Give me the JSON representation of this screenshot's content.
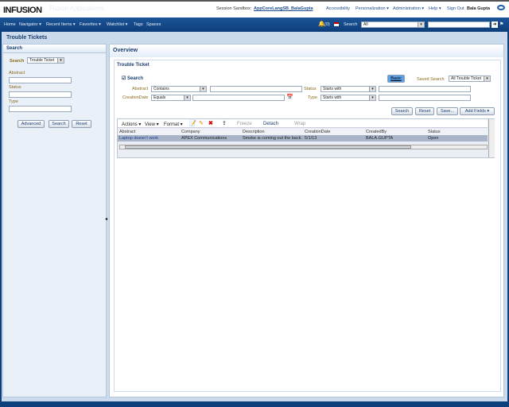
{
  "header": {
    "logo": "INFUSION",
    "app_title": "Fusion Applications",
    "session_label": "Session Sandbox:",
    "session_name": "AppCoreLangSB_BalaGupta",
    "links": [
      "Accessibility",
      "Personalization ▾",
      "Administration ▾",
      "Help ▾",
      "Sign Out"
    ],
    "user": "Bala Gupta"
  },
  "nav": {
    "items": [
      "Home",
      "Navigator ▾",
      "Recent Items ▾",
      "Favorites ▾",
      "Watchlist ▾",
      "Tags",
      "Spaces"
    ],
    "notifications": "(0)",
    "search_label": "Search",
    "search_scope": "All",
    "search_value": ""
  },
  "page_title": "Trouble Tickets",
  "left": {
    "title": "Search",
    "search_label": "Search",
    "search_object": "Trouble Ticket",
    "fields": [
      "Abstract",
      "Status",
      "Type"
    ],
    "buttons": [
      "Advanced",
      "Search",
      "Reset"
    ]
  },
  "main": {
    "title": "Overview",
    "section": "Trouble Ticket",
    "search_toggle": "Search",
    "basic": "Basic",
    "saved_search_label": "Saved Search",
    "saved_search": "All Trouble Ticket",
    "criteria": [
      {
        "label": "Abstract",
        "op": "Contains"
      },
      {
        "label": "CreationDate",
        "op": "Equals"
      },
      {
        "label": "Status",
        "op": "Starts with"
      },
      {
        "label": "Type",
        "op": "Starts with"
      }
    ],
    "buttons": [
      "Search",
      "Reset",
      "Save...",
      "Add Fields ▾"
    ],
    "toolbar": {
      "actions": "Actions ▾",
      "view": "View ▾",
      "format": "Format ▾",
      "freeze": "Freeze",
      "detach": "Detach",
      "wrap": "Wrap"
    },
    "columns": [
      "Abstract",
      "Company",
      "Description",
      "CreationDate",
      "CreatedBy",
      "Status"
    ],
    "rows": [
      [
        "Laptop doesn't work",
        "APEX Communications",
        "Smoke is coming out the back.",
        "5/1/13",
        "BALA.GUPTA",
        "Open"
      ]
    ]
  }
}
